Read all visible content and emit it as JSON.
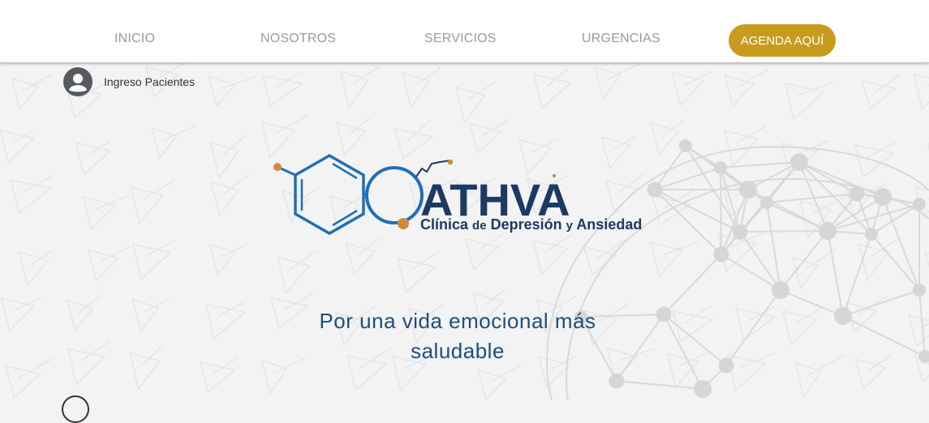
{
  "nav": {
    "items": [
      {
        "label": "INICIO"
      },
      {
        "label": "NOSOTROS"
      },
      {
        "label": "SERVICIOS"
      },
      {
        "label": "URGENCIAS"
      }
    ],
    "cta_label": "AGENDA AQUÍ"
  },
  "login": {
    "label": "Ingreso Pacientes",
    "icon": "user-avatar-icon"
  },
  "logo": {
    "brand": "ATHVA",
    "subtitle_a": "Clínica",
    "subtitle_b": "de",
    "subtitle_c": "Depresión",
    "subtitle_d": "y",
    "subtitle_e": "Ansiedad"
  },
  "hero": {
    "tagline_line1": "Por una vida emocional más",
    "tagline_line2": "saludable"
  },
  "colors": {
    "accent": "#c89a1e",
    "brand_blue": "#1f6fb8",
    "brand_dark": "#1c3a63",
    "molecule_orange": "#d08a3b",
    "nav_text": "#9a9a9a"
  }
}
